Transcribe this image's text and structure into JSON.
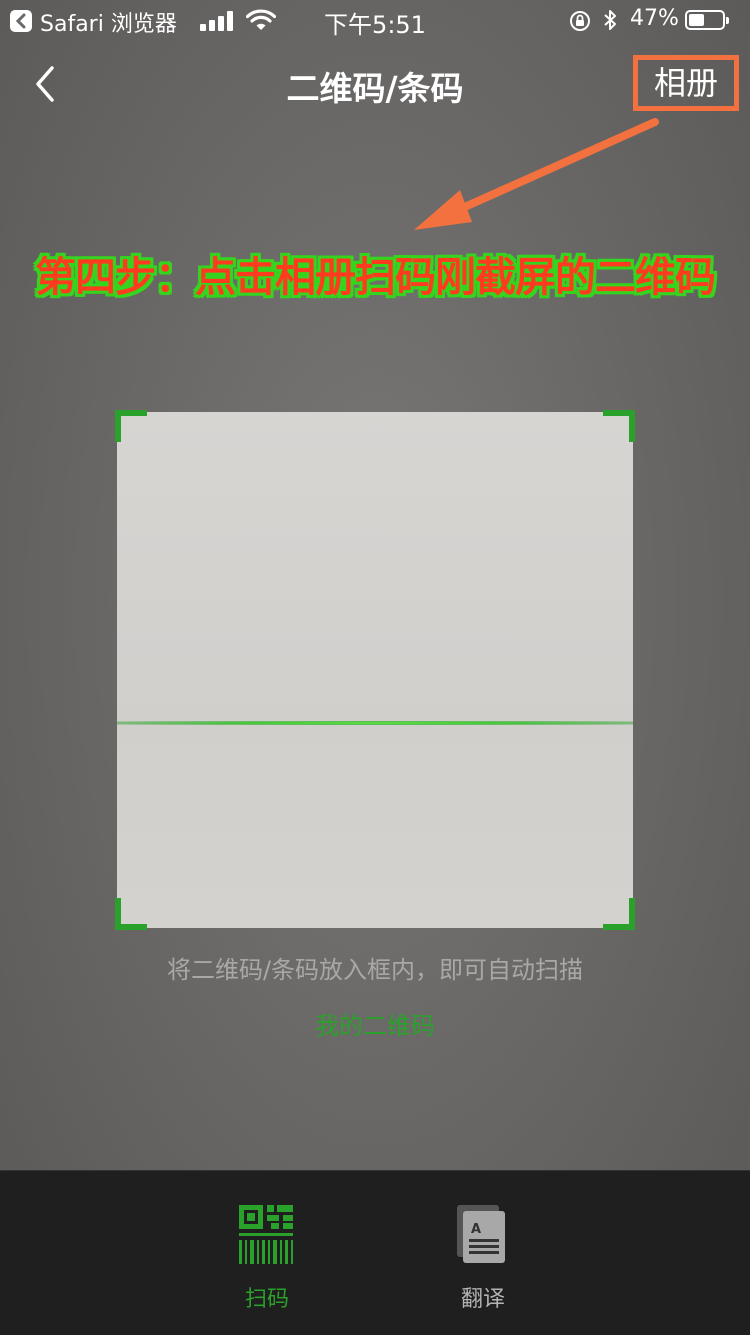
{
  "status_bar": {
    "app_name": "Safari 浏览器",
    "time": "下午5:51",
    "battery_percent": "47%",
    "battery_level": 0.47
  },
  "nav": {
    "title": "二维码/条码",
    "album_label": "相册"
  },
  "annotation": {
    "text": "第四步：点击相册扫码刚截屏的二维码",
    "highlight_color": "#f3713f"
  },
  "scanner": {
    "hint": "将二维码/条码放入框内，即可自动扫描",
    "my_qr_link": "我的二维码",
    "accent_color": "#2aa12a"
  },
  "tabs": [
    {
      "label": "扫码",
      "icon": "qr-barcode-icon",
      "active": true
    },
    {
      "label": "翻译",
      "icon": "translate-document-icon",
      "active": false
    }
  ]
}
